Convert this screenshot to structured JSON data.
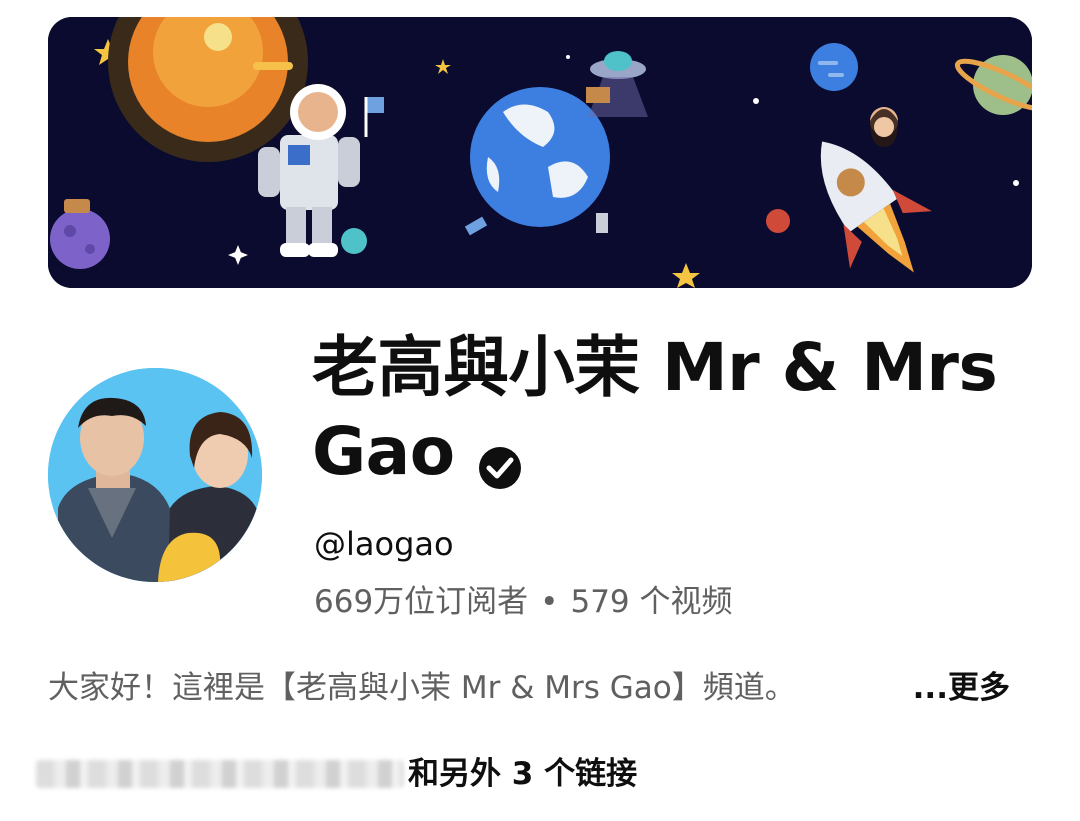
{
  "channel": {
    "name": "老高與小茉 Mr & Mrs Gao",
    "handle": "@laogao",
    "subscribers": "669万位订阅者",
    "separator": "•",
    "videos": "579 个视频",
    "description": "大家好！這裡是【老高與小茉 Mr & Mrs Gao】頻道。",
    "more_label": "...更多",
    "links_text": "和另外 3 个链接"
  },
  "icons": {
    "verified": "verified-check-icon"
  },
  "colors": {
    "banner_bg": "#0a0b2e",
    "avatar_bg": "#5bc3f2",
    "primary_text": "#0f0f0f",
    "secondary_text": "#606060"
  }
}
